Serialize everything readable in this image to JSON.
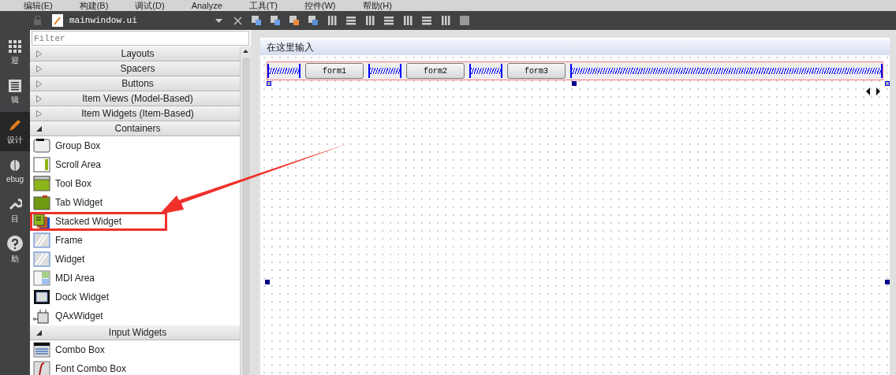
{
  "menu": [
    "编辑(E)",
    "构建(B)",
    "调试(D)",
    "Analyze",
    "工具(T)",
    "控件(W)",
    "帮助(H)"
  ],
  "modes": [
    {
      "label": "迎",
      "kind": "grid",
      "selected": false
    },
    {
      "label": "辑",
      "kind": "document",
      "selected": false
    },
    {
      "label": "设计",
      "kind": "pencil",
      "selected": true
    },
    {
      "label": "ebug",
      "kind": "bug",
      "selected": false
    },
    {
      "label": "目",
      "kind": "wrench",
      "selected": false
    },
    {
      "label": "助",
      "kind": "help",
      "selected": false
    }
  ],
  "file_toolbar": {
    "file_name": "mainwindow.ui"
  },
  "widget_box": {
    "filter_placeholder": "Filter",
    "categories": [
      {
        "name": "Layouts",
        "expanded": false
      },
      {
        "name": "Spacers",
        "expanded": false
      },
      {
        "name": "Buttons",
        "expanded": false
      },
      {
        "name": "Item Views (Model-Based)",
        "expanded": false
      },
      {
        "name": "Item Widgets (Item-Based)",
        "expanded": false
      },
      {
        "name": "Containers",
        "expanded": true,
        "items": [
          {
            "label": "Group Box",
            "kind": "group",
            "highlighted": false
          },
          {
            "label": "Scroll Area",
            "kind": "scroll",
            "highlighted": false
          },
          {
            "label": "Tool Box",
            "kind": "toolbox",
            "highlighted": false
          },
          {
            "label": "Tab Widget",
            "kind": "tab",
            "highlighted": false
          },
          {
            "label": "Stacked Widget",
            "kind": "stacked",
            "highlighted": true
          },
          {
            "label": "Frame",
            "kind": "frame",
            "highlighted": false
          },
          {
            "label": "Widget",
            "kind": "frame",
            "highlighted": false
          },
          {
            "label": "MDI Area",
            "kind": "mdi",
            "highlighted": false
          },
          {
            "label": "Dock Widget",
            "kind": "dock",
            "highlighted": false
          },
          {
            "label": "QAxWidget",
            "kind": "qax",
            "highlighted": false
          }
        ]
      },
      {
        "name": "Input Widgets",
        "expanded": true,
        "items": [
          {
            "label": "Combo Box",
            "kind": "combo",
            "highlighted": false
          },
          {
            "label": "Font Combo Box",
            "kind": "font",
            "highlighted": false
          }
        ]
      }
    ]
  },
  "form": {
    "menu_placeholder": "在这里输入",
    "layout": [
      {
        "kind": "spacer"
      },
      {
        "kind": "button",
        "label": "form1"
      },
      {
        "kind": "spacer"
      },
      {
        "kind": "button",
        "label": "form2"
      },
      {
        "kind": "spacer"
      },
      {
        "kind": "button",
        "label": "form3"
      },
      {
        "kind": "stretch"
      }
    ]
  }
}
